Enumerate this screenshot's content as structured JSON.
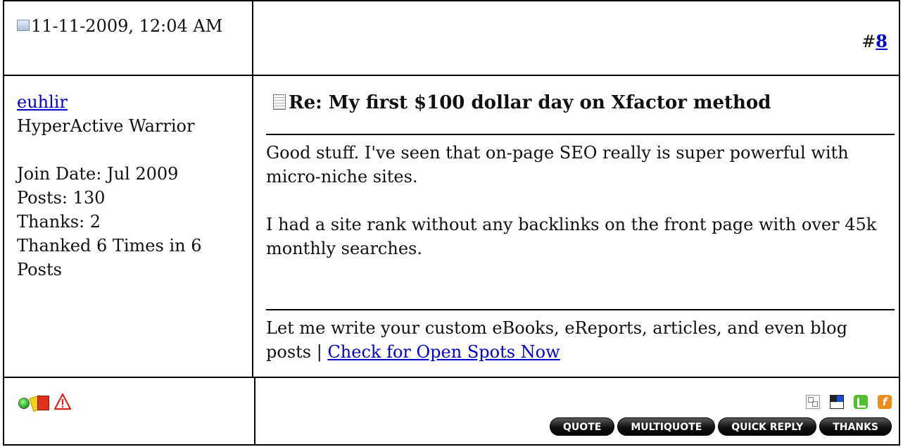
{
  "post": {
    "date": "11-11-2009, 12:04 AM",
    "number_prefix": "#",
    "number": "8",
    "user": {
      "name": "euhlir",
      "title": "HyperActive Warrior",
      "join_date": "Join Date: Jul 2009",
      "posts": "Posts: 130",
      "thanks": "Thanks: 2",
      "thanked": "Thanked 6 Times in 6 Posts"
    },
    "title": "Re: My first $100 dollar day on Xfactor method",
    "body": [
      "Good stuff. I've seen that on-page SEO really is super powerful with micro-niche sites.",
      "I had a site rank without any backlinks on the front page with over 45k monthly searches."
    ],
    "signature": {
      "text": "Let me write your custom eBooks, eReports, articles, and even blog posts | ",
      "link": "Check for Open Spots Now"
    },
    "status_icons": [
      "online-icon",
      "report-cards-icon",
      "report-post-icon"
    ],
    "social_icons": [
      "digg-icon",
      "delicious-icon",
      "technorati-icon",
      "furl-icon"
    ],
    "buttons": {
      "quote": "QUOTE",
      "multiquote": "MULTIQUOTE",
      "quick_reply": "QUICK REPLY",
      "thanks": "THANKS"
    },
    "colors": {
      "link": "#0000cc",
      "button_bg": "#111111",
      "border": "#000000"
    }
  }
}
